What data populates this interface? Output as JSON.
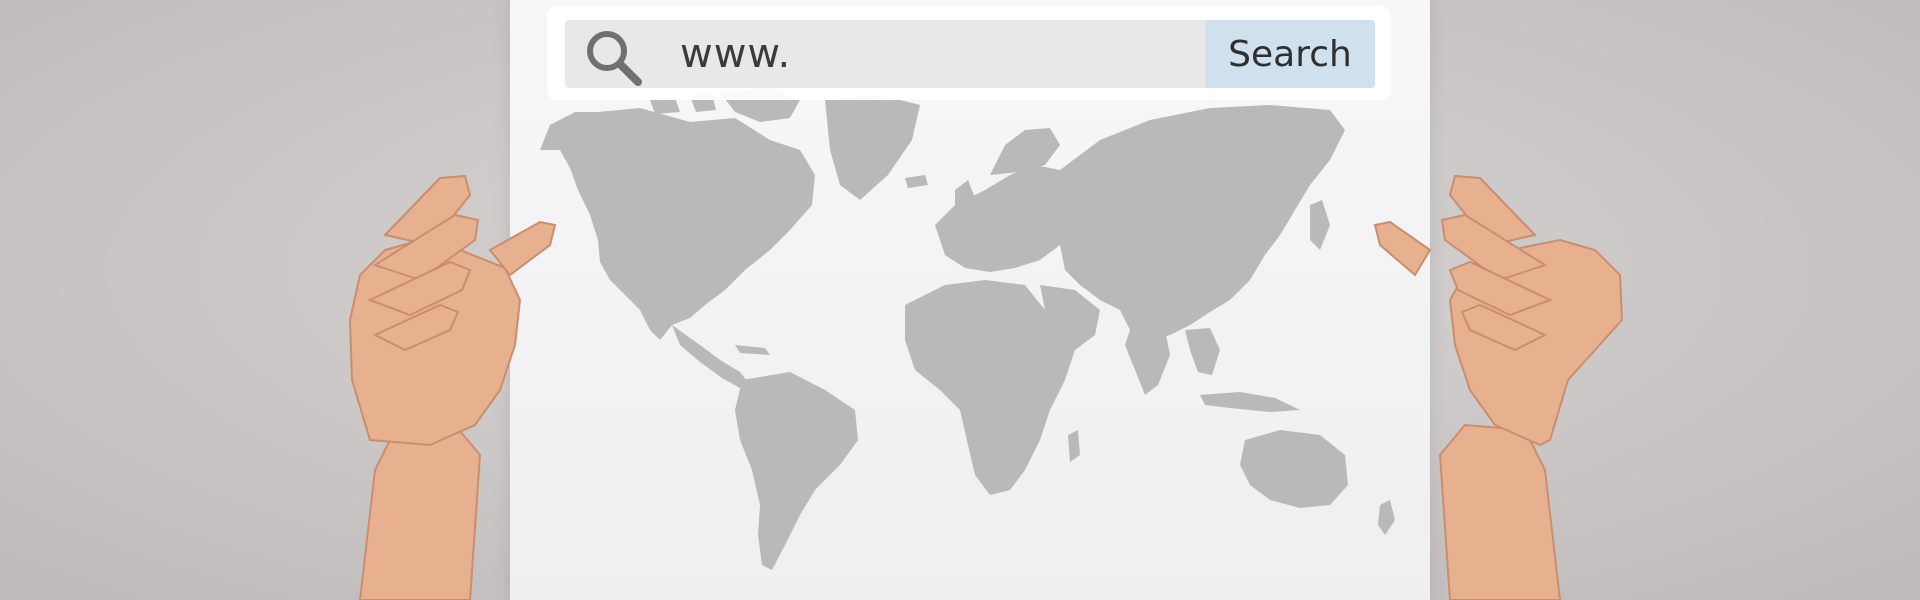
{
  "search": {
    "url_text": "www.",
    "button_label": "Search"
  },
  "icons": {
    "search": "magnifying-glass-icon"
  },
  "colors": {
    "background": "#cdc9c9",
    "paper": "#f3f3f5",
    "continents": "#b9b9bb",
    "search_field": "#e8e8e8",
    "search_button": "#cfe1ec",
    "skin": "#e8b392"
  }
}
